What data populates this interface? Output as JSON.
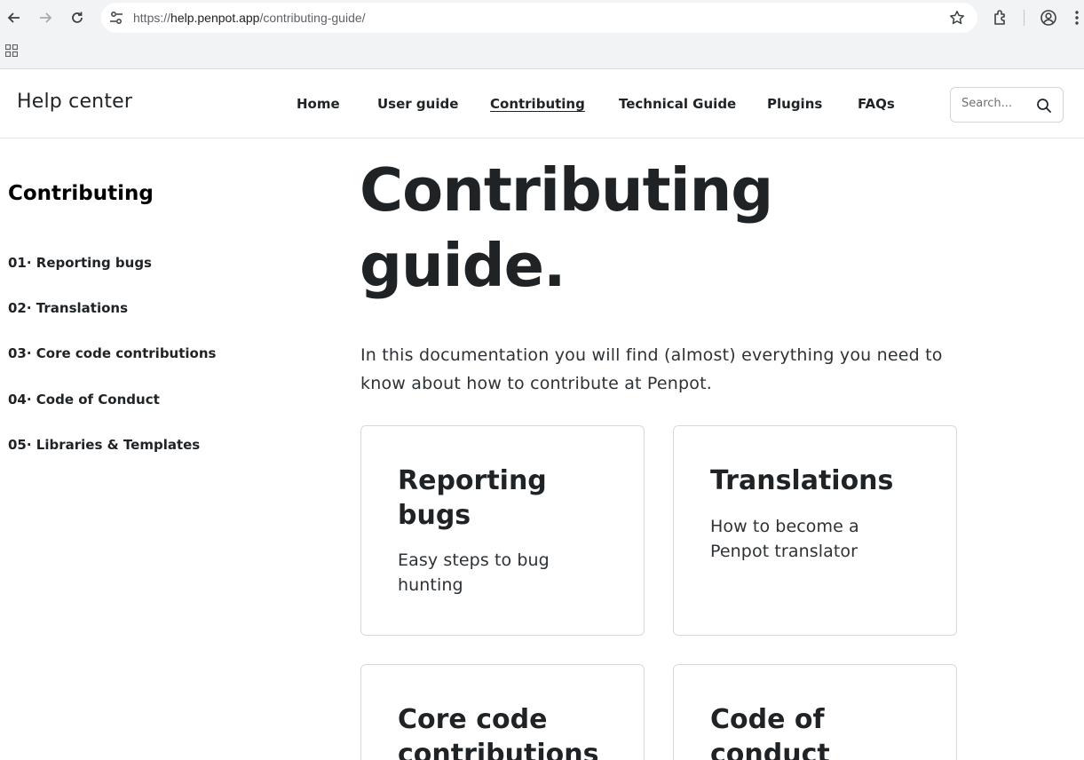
{
  "browser": {
    "url_scheme": "https://",
    "url_host": "help.penpot.app",
    "url_path": "/contributing-guide/"
  },
  "header": {
    "brand": "Help center",
    "nav": [
      {
        "label": "Home"
      },
      {
        "label": "User guide"
      },
      {
        "label": "Contributing",
        "active": true
      },
      {
        "label": "Technical Guide"
      },
      {
        "label": "Plugins"
      },
      {
        "label": "FAQs"
      }
    ],
    "search_placeholder": "Search..."
  },
  "sidebar": {
    "title": "Contributing",
    "items": [
      {
        "label": "01· Reporting bugs"
      },
      {
        "label": "02· Translations"
      },
      {
        "label": "03· Core code contributions"
      },
      {
        "label": "04· Code of Conduct"
      },
      {
        "label": "05· Libraries & Templates"
      }
    ]
  },
  "main": {
    "title_line1": "Contributing",
    "title_line2": "guide.",
    "intro": "In this documentation you will find (almost) everything you need to know about how to contribute at Penpot.",
    "cards": [
      {
        "title": "Reporting bugs",
        "desc": "Easy steps to bug hunting"
      },
      {
        "title": "Translations",
        "desc": "How to become a Penpot translator"
      },
      {
        "title": "Core code contributions",
        "desc": ""
      },
      {
        "title": "Code of conduct",
        "desc": ""
      }
    ]
  },
  "colors": {
    "text": "#1f2326",
    "chrome_bg": "#f1f3f4",
    "border": "#d6d9dc"
  }
}
